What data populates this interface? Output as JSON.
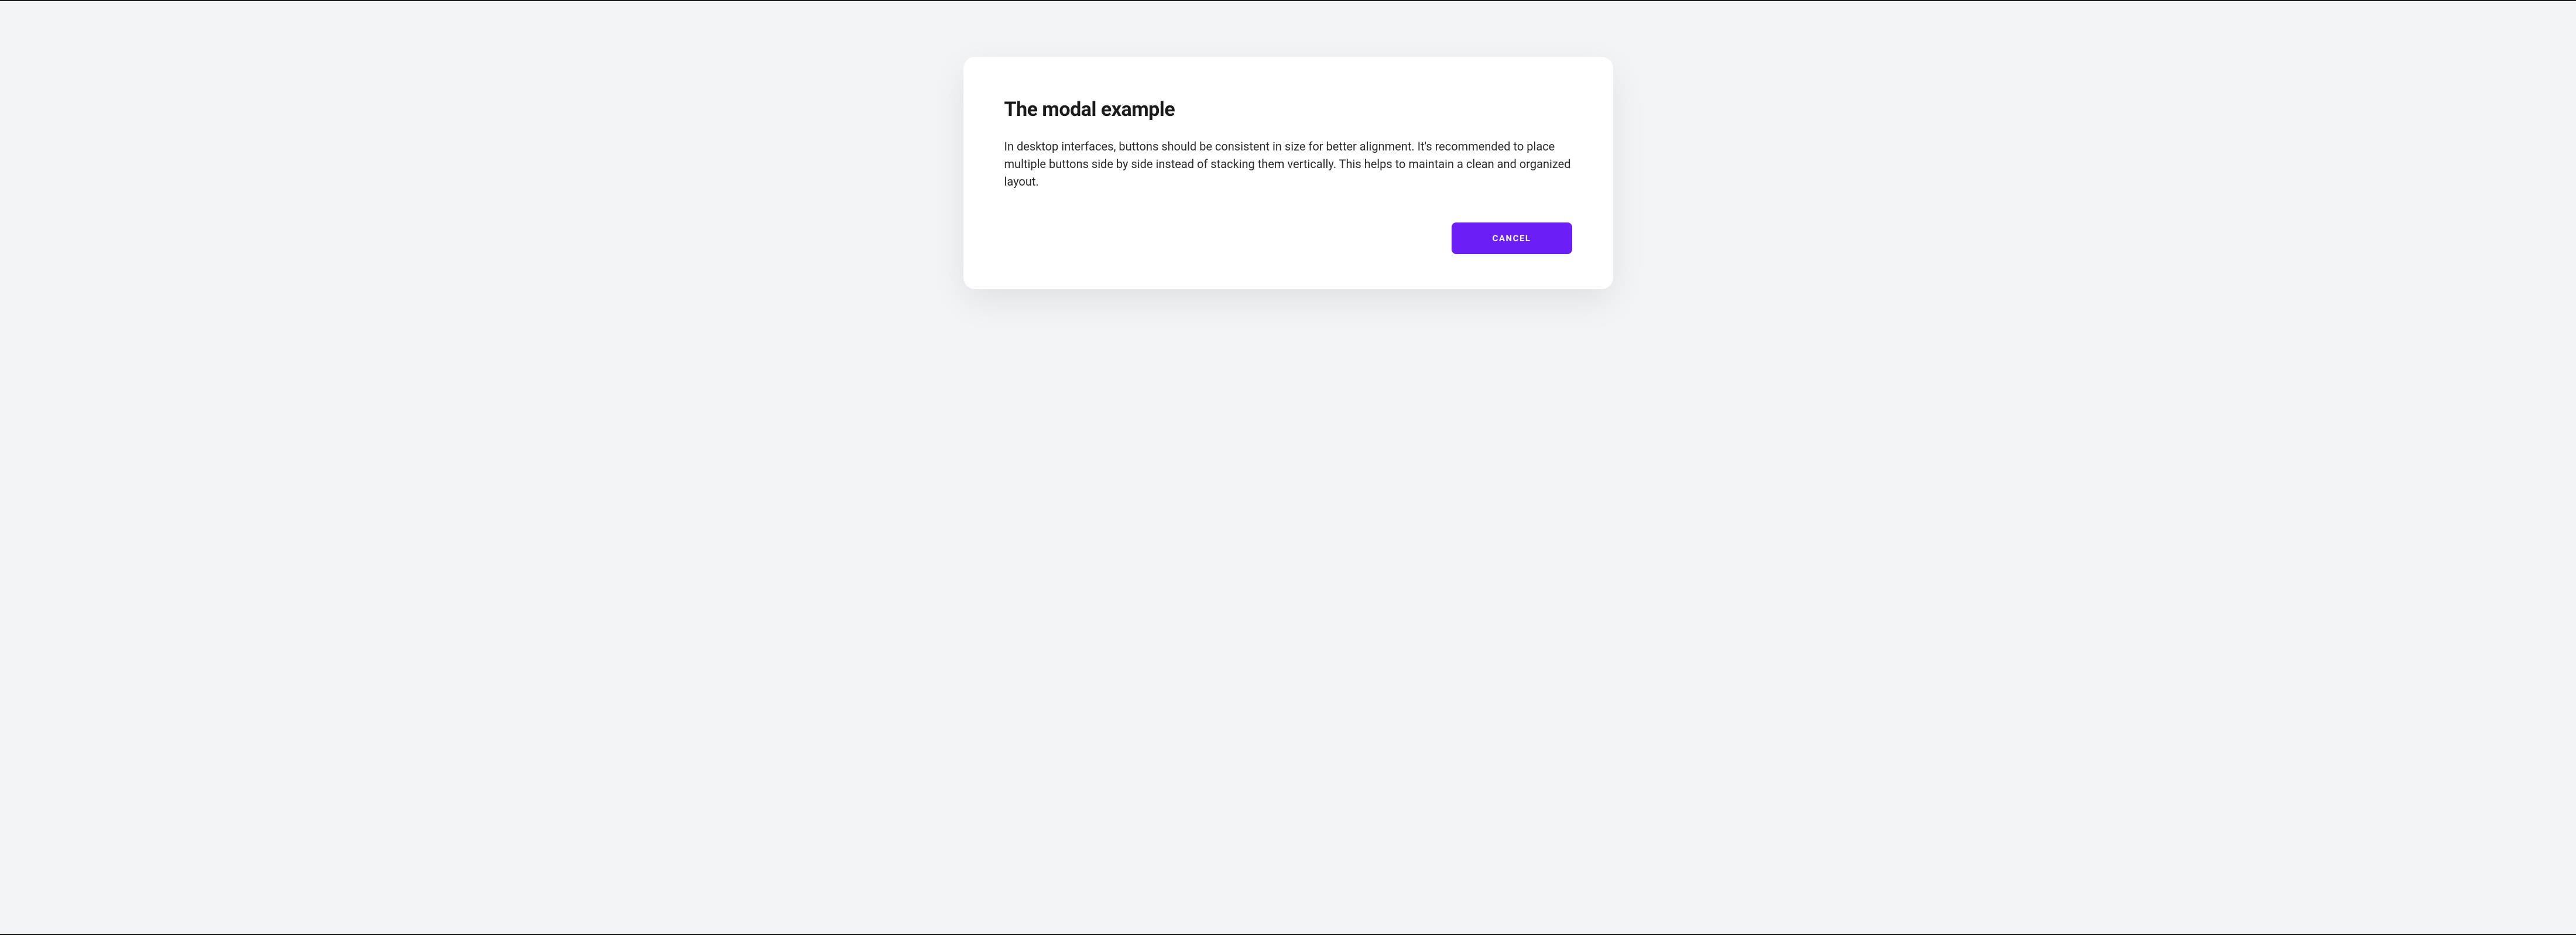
{
  "modal": {
    "title": "The modal example",
    "body": "In desktop interfaces, buttons should be consistent in size for better alignment. It's recommended to place multiple buttons side by side instead of stacking them vertically. This helps to maintain a clean and organized layout.",
    "cancel_label": "CANCEL"
  },
  "colors": {
    "accent": "#6b1ef5",
    "background": "#f3f4f6",
    "modal_background": "#ffffff",
    "text_primary": "#1a1a1a",
    "text_body": "#2a2a2a"
  }
}
